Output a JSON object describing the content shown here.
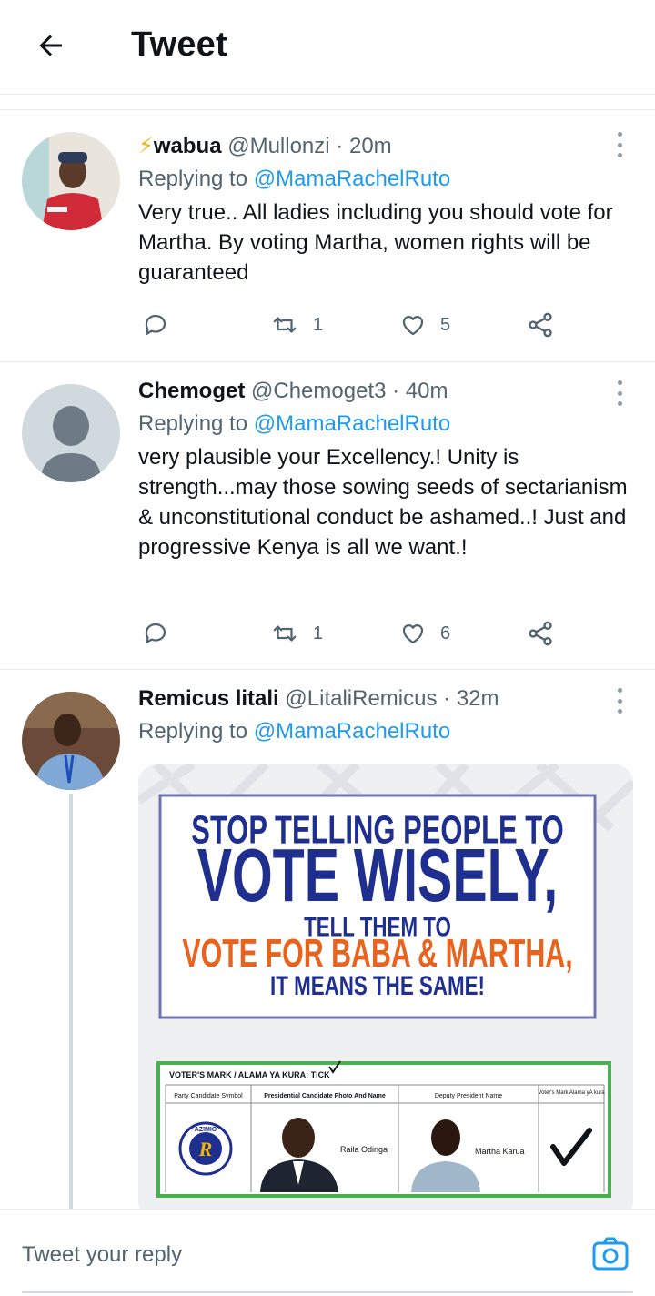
{
  "header": {
    "title": "Tweet"
  },
  "tweets": [
    {
      "emoji": "⚡",
      "name": "wabua",
      "handle": "@Mullonzi",
      "sep": "·",
      "time": "20m",
      "replying_prefix": "Replying to",
      "replying_handle": "@MamaRachelRuto",
      "text": "Very true.. All ladies including you should vote for Martha. By voting Martha, women rights will be guaranteed",
      "retweets": "1",
      "likes": "5"
    },
    {
      "name": "Chemoget",
      "handle": "@Chemoget3",
      "sep": "·",
      "time": "40m",
      "replying_prefix": "Replying to",
      "replying_handle": "@MamaRachelRuto",
      "text": "very plausible your Excellency.! Unity is strength...may those sowing seeds of sectarianism & unconstitutional conduct be ashamed..! Just and progressive Kenya is all we want.!",
      "retweets": "1",
      "likes": "6"
    },
    {
      "name": "Remicus litali",
      "handle": "@LitaliRemicus",
      "sep": "·",
      "time": "32m",
      "replying_prefix": "Replying to",
      "replying_handle": "@MamaRachelRuto"
    }
  ],
  "poster": {
    "line1": "STOP TELLING PEOPLE TO",
    "line2": "VOTE WISELY,",
    "line3": "TELL THEM TO",
    "line4": "VOTE FOR BABA & MARTHA,",
    "line5": "IT MEANS THE SAME!",
    "ballot_title": "VOTER'S MARK / ALAMA YA KURA: TICK",
    "col1": "Party Candidate Symbol",
    "col2": "Presidential Candidate Photo And Name",
    "col3": "Deputy President Name",
    "col4": "Voter's Mark Alama yA kura",
    "party_badge": "AZIMIO",
    "party_letter": "R",
    "candidate1": "Raila Odinga",
    "candidate2": "Martha Karua",
    "colors": {
      "blue": "#1f2f8f",
      "orange": "#e8641e",
      "green": "#4caf50"
    }
  },
  "reply_bar": {
    "placeholder": "Tweet your reply"
  },
  "colors": {
    "link": "#1d9bf0",
    "muted": "#536471"
  },
  "icons": [
    "back-arrow-icon",
    "more-icon",
    "reply-icon",
    "retweet-icon",
    "like-icon",
    "share-icon",
    "camera-icon"
  ]
}
